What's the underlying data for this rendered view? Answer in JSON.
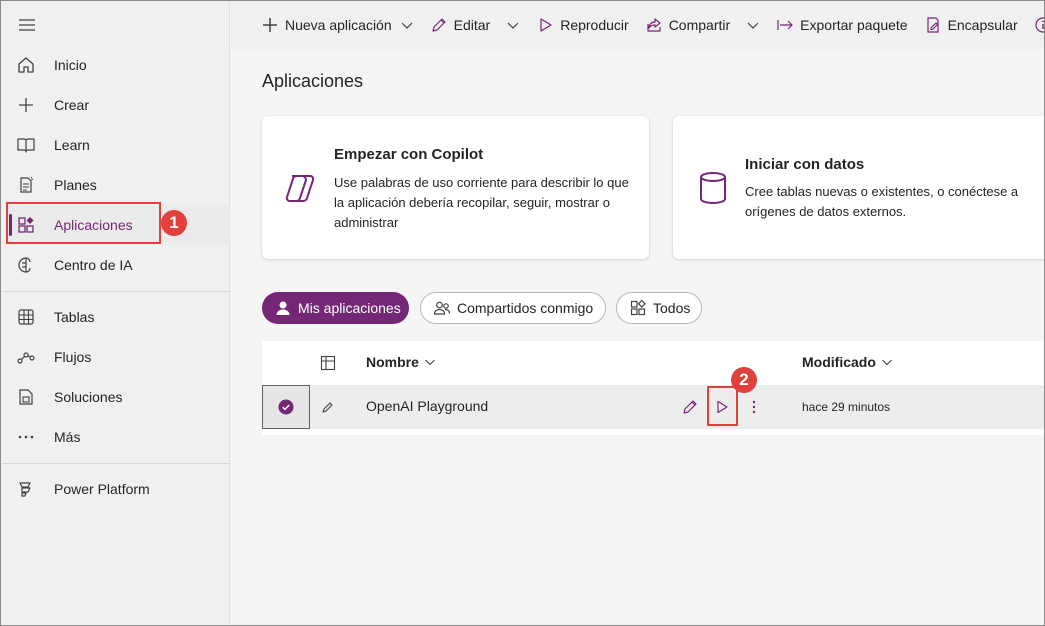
{
  "sidebar": {
    "items": [
      {
        "label": "Inicio",
        "icon": "home-icon"
      },
      {
        "label": "Crear",
        "icon": "plus-icon"
      },
      {
        "label": "Learn",
        "icon": "book-icon"
      },
      {
        "label": "Planes",
        "icon": "plan-icon"
      },
      {
        "label": "Aplicaciones",
        "icon": "apps-icon",
        "active": true
      },
      {
        "label": "Centro de IA",
        "icon": "brain-icon"
      },
      {
        "label": "Tablas",
        "icon": "table-icon"
      },
      {
        "label": "Flujos",
        "icon": "flow-icon"
      },
      {
        "label": "Soluciones",
        "icon": "solutions-icon"
      },
      {
        "label": "Más",
        "icon": "more-icon"
      },
      {
        "label": "Power Platform",
        "icon": "power-platform-icon"
      }
    ]
  },
  "toolbar": {
    "new_app": "Nueva aplicación",
    "edit": "Editar",
    "play": "Reproducir",
    "share": "Compartir",
    "export": "Exportar paquete",
    "wrap": "Encapsular"
  },
  "page": {
    "title": "Aplicaciones"
  },
  "cards": [
    {
      "title": "Empezar con Copilot",
      "desc": "Use palabras de uso corriente para describir lo que la aplicación debería recopilar, seguir, mostrar o administrar"
    },
    {
      "title": "Iniciar con datos",
      "desc": "Cree tablas nuevas o existentes, o conéctese a orígenes de datos externos."
    }
  ],
  "filters": {
    "mine": "Mis aplicaciones",
    "shared": "Compartidos conmigo",
    "all": "Todos"
  },
  "table": {
    "headers": {
      "name": "Nombre",
      "modified": "Modificado"
    },
    "rows": [
      {
        "name": "OpenAI Playground",
        "modified": "hace 29 minutos"
      }
    ]
  },
  "annotations": {
    "step1": "1",
    "step2": "2"
  },
  "colors": {
    "accent": "#742774",
    "annotation": "#e0413b"
  }
}
